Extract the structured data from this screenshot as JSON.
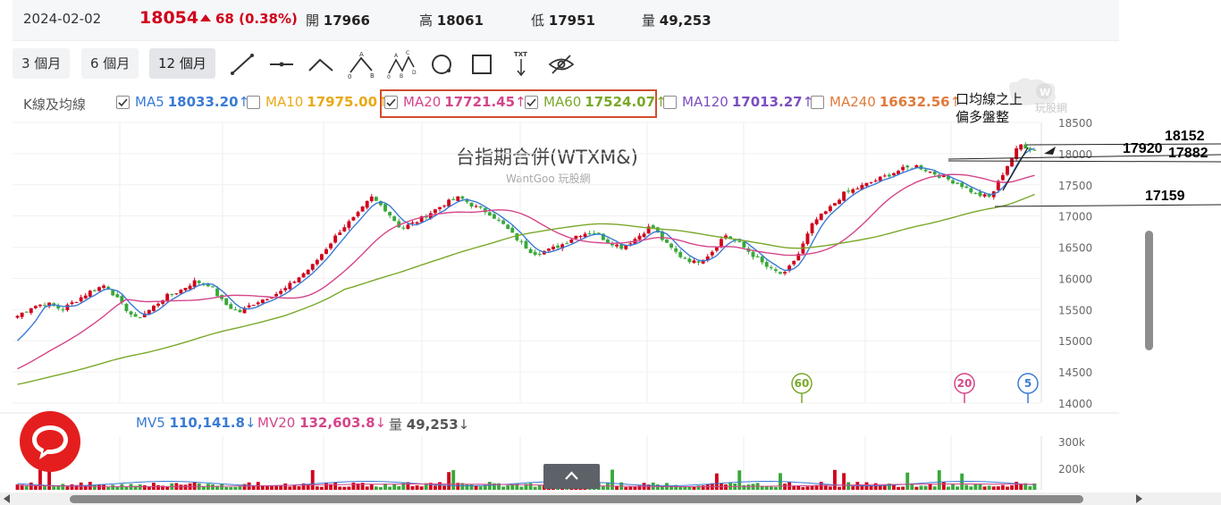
{
  "quote": {
    "date": "2024-02-02",
    "price": "18054",
    "change": "68 (0.38%)",
    "open_label": "開",
    "open": "17966",
    "high_label": "高",
    "high": "18061",
    "low_label": "低",
    "low": "17951",
    "vol_label": "量",
    "vol": "49,253"
  },
  "ranges": [
    "3 個月",
    "6 個月",
    "12 個月"
  ],
  "active_range": "12 個月",
  "tools": [
    "line-tool-icon",
    "horizontal-line-tool-icon",
    "angle-tool-icon",
    "abc-pattern-tool-icon",
    "abcd-pattern-tool-icon",
    "circle-tool-icon",
    "rectangle-tool-icon",
    "text-tool-icon",
    "hide-drawings-icon"
  ],
  "ma_bar": {
    "label": "K線及均線",
    "items": [
      {
        "name": "MA5",
        "value": "18033.20",
        "arrow": "↑",
        "checked": true,
        "color": "#3a7bd5"
      },
      {
        "name": "MA10",
        "value": "17975.00",
        "arrow": "↑",
        "checked": false,
        "color": "#e8a915"
      },
      {
        "name": "MA20",
        "value": "17721.45",
        "arrow": "↑",
        "checked": true,
        "color": "#d4468a"
      },
      {
        "name": "MA60",
        "value": "17524.07",
        "arrow": "↑",
        "checked": true,
        "color": "#7aa82a"
      },
      {
        "name": "MA120",
        "value": "17013.27",
        "arrow": "↑",
        "checked": false,
        "color": "#7b4fc0"
      },
      {
        "name": "MA240",
        "value": "16632.56",
        "arrow": "↑",
        "checked": false,
        "color": "#e07a3c"
      }
    ]
  },
  "chart_data": {
    "type": "candlestick",
    "title": "台指期合併(WTXM&)",
    "watermark": "WantGoo 玩股網",
    "y_ticks": [
      18500,
      18000,
      17500,
      17000,
      16500,
      16000,
      15500,
      15000,
      14500,
      14000
    ],
    "ylim": [
      14000,
      18500
    ],
    "close_path": [
      15400,
      15550,
      15600,
      15500,
      15650,
      15800,
      15900,
      15600,
      15350,
      15500,
      15700,
      15800,
      15950,
      15900,
      15600,
      15450,
      15600,
      15700,
      15800,
      16000,
      16200,
      16500,
      16800,
      17000,
      17300,
      17100,
      16800,
      16900,
      17050,
      17200,
      17300,
      17150,
      17050,
      16850,
      16600,
      16400,
      16450,
      16550,
      16700,
      16750,
      16600,
      16500,
      16650,
      16850,
      16550,
      16350,
      16250,
      16400,
      16700,
      16550,
      16350,
      16150,
      16050,
      16400,
      16900,
      17100,
      17350,
      17450,
      17550,
      17650,
      17750,
      17800,
      17700,
      17600,
      17500,
      17350,
      17300,
      17750,
      18150,
      18050
    ],
    "ma_series": [
      {
        "name": "MA5",
        "color": "#3a7bd5",
        "start": 15000
      },
      {
        "name": "MA20",
        "color": "#d4468a",
        "start": 14550
      },
      {
        "name": "MA60",
        "color": "#7aa82a",
        "start": 14300
      }
    ],
    "ma_markers": [
      {
        "label": "60",
        "color": "#7aa82a"
      },
      {
        "label": "20",
        "color": "#d4468a"
      },
      {
        "label": "5",
        "color": "#3a7bd5"
      }
    ],
    "annotations": {
      "note_line1": "口均線之上",
      "note_line2": "偏多盤整",
      "level_18152": "18152",
      "level_17920": "17920",
      "level_17882": "17882",
      "level_17159": "17159"
    },
    "volume": {
      "legend": [
        {
          "name": "MV5",
          "value": "110,141.8",
          "arrow": "↓",
          "color": "#3a7bd5"
        },
        {
          "name": "MV20",
          "value": "132,603.8",
          "arrow": "↓",
          "color": "#d4468a"
        },
        {
          "name": "量",
          "value": "49,253",
          "arrow": "↓",
          "color": "#555555"
        }
      ],
      "y_ticks": [
        "300k",
        "200k"
      ]
    }
  },
  "logo_text": "玩股網"
}
